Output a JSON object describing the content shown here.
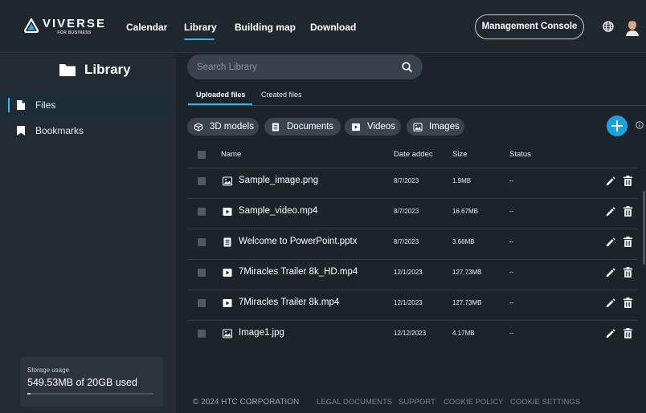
{
  "header": {
    "logo_main": "VIVERSE",
    "logo_sub": "FOR BUSINESS",
    "nav": [
      {
        "label": "Calendar"
      },
      {
        "label": "Library"
      },
      {
        "label": "Building map"
      },
      {
        "label": "Download"
      }
    ],
    "console_button": "Management Console",
    "globe_icon": "globe-icon",
    "avatar_icon": "user-avatar"
  },
  "sidebar": {
    "title": "Library",
    "items": [
      {
        "label": "Files",
        "icon": "file-icon"
      },
      {
        "label": "Bookmarks",
        "icon": "bookmark-icon"
      }
    ],
    "storage": {
      "label": "Storage usage",
      "value": "549.53MB of 20GB used",
      "used_fraction": 0.027
    }
  },
  "main": {
    "search_placeholder": "Search Library",
    "tabs": [
      {
        "label": "Uploaded files"
      },
      {
        "label": "Created files"
      }
    ],
    "filters": [
      {
        "label": "3D models",
        "icon": "cube-icon"
      },
      {
        "label": "Documents",
        "icon": "document-icon"
      },
      {
        "label": "Videos",
        "icon": "video-icon"
      },
      {
        "label": "Images",
        "icon": "image-icon"
      }
    ],
    "table": {
      "headers": {
        "name": "Name",
        "date": "Date addec",
        "size": "Size",
        "status": "Status"
      },
      "rows": [
        {
          "type": "image",
          "name": "Sample_image.png",
          "date": "8/7/2023",
          "size": "1.9MB",
          "status": "--"
        },
        {
          "type": "video",
          "name": "Sample_video.mp4",
          "date": "8/7/2023",
          "size": "16.67MB",
          "status": "--"
        },
        {
          "type": "document",
          "name": "Welcome to PowerPoint.pptx",
          "date": "8/7/2023",
          "size": "3.66MB",
          "status": "--"
        },
        {
          "type": "video",
          "name": "7Miracles Trailer 8k_HD.mp4",
          "date": "12/1/2023",
          "size": "127.73MB",
          "status": "--"
        },
        {
          "type": "video",
          "name": "7Miracles Trailer 8k.mp4",
          "date": "12/1/2023",
          "size": "127.73MB",
          "status": "--"
        },
        {
          "type": "image",
          "name": "Image1.jpg",
          "date": "12/12/2023",
          "size": "4.17MB",
          "status": "--"
        }
      ]
    }
  },
  "footer": {
    "copyright": "© 2024 HTC CORPORATION",
    "links": [
      {
        "label": "LEGAL DOCUMENTS"
      },
      {
        "label": "SUPPORT"
      },
      {
        "label": "COOKIE POLICY"
      },
      {
        "label": "COOKIE SETTINGS"
      }
    ]
  },
  "colors": {
    "accent": "#38b8ea",
    "add_button": "#1ea0dc",
    "background": "#1c232b",
    "sidebar": "#232c35"
  }
}
